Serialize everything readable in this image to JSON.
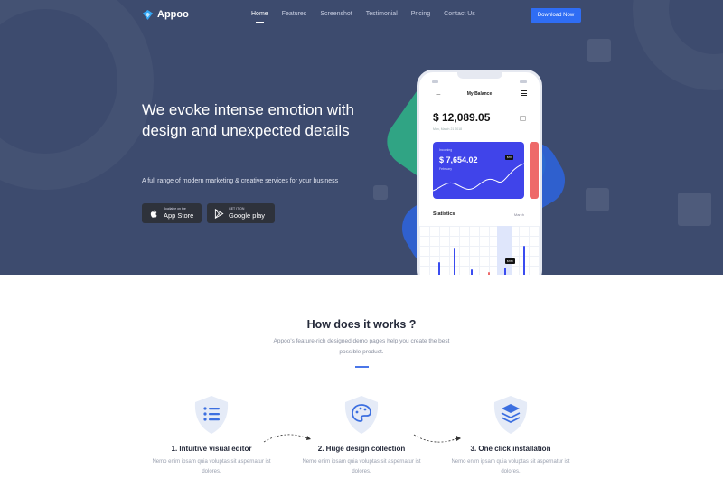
{
  "brand": {
    "name": "Appoo"
  },
  "nav": {
    "items": [
      "Home",
      "Features",
      "Screenshot",
      "Testimonial",
      "Pricing",
      "Contact Us"
    ],
    "active_index": 0,
    "cta_label": "Download Now"
  },
  "hero": {
    "headline": "We evoke intense emotion with design and unexpected details",
    "subtitle": "A full range of modern marketing & creative services for your business",
    "app_store": {
      "small": "Available on the",
      "big": "App Store"
    },
    "google_play": {
      "small": "GET IT ON",
      "big": "Google play"
    }
  },
  "phone": {
    "title": "My Balance",
    "balance": "$ 12,089.05",
    "date": "Mon, March 21 2018",
    "card": {
      "label": "Incoming",
      "value": "$ 7,654.02",
      "sub": "February",
      "tag": "$7K"
    },
    "stats_label": "Statistics",
    "stats_period": "March",
    "tooltip": "$780"
  },
  "how": {
    "title": "How does it works ?",
    "description": "Appoo's feature-rich designed demo pages help you create the best possible product.",
    "steps": [
      {
        "title": "1. Intuitive visual editor",
        "desc": "Nemo enim ipsam quia voluptas sit aspernatur ist dolores.",
        "icon": "list-icon"
      },
      {
        "title": "2. Huge design collection",
        "desc": "Nemo enim ipsam quia voluptas sit aspernatur ist dolores.",
        "icon": "palette-icon"
      },
      {
        "title": "3. One click installation",
        "desc": "Nemo enim ipsam quia voluptas sit aspernatur ist dolores.",
        "icon": "layers-icon"
      }
    ]
  },
  "colors": {
    "hero_bg": "#3d4b6e",
    "accent": "#2f6df4",
    "card": "#4044ea",
    "green_shape": "#2fae86",
    "red_accent": "#ee6a6a"
  }
}
